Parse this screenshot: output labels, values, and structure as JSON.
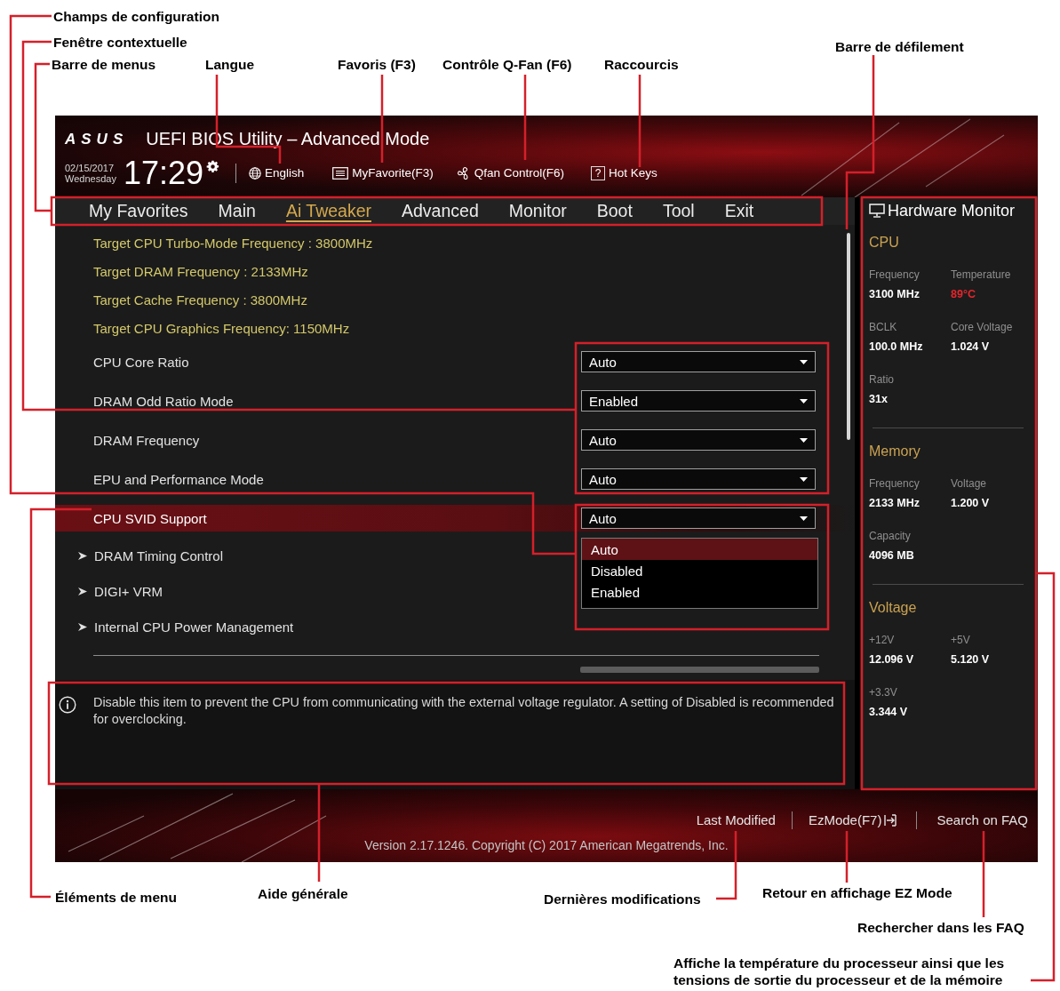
{
  "callouts": [
    {
      "text": "Champs de configuration"
    },
    {
      "text": "Fenêtre contextuelle"
    },
    {
      "text": "Barre de menus"
    },
    {
      "text": "Langue"
    },
    {
      "text": "Favoris (F3)"
    },
    {
      "text": "Contrôle Q-Fan (F6)"
    },
    {
      "text": "Raccourcis"
    },
    {
      "text": "Barre de défilement"
    },
    {
      "text": "Éléments de menu"
    },
    {
      "text": "Aide générale"
    },
    {
      "text": "Dernières modifications"
    },
    {
      "text": "Retour en affichage EZ Mode"
    },
    {
      "text": "Rechercher dans les FAQ"
    },
    {
      "text": "Affiche la température du processeur ainsi que les tensions de sortie du processeur et de la mémoire"
    }
  ],
  "header": {
    "logo": "ASUS",
    "title": "UEFI BIOS Utility – Advanced Mode",
    "date": "02/15/2017",
    "weekday": "Wednesday",
    "time": "17:29",
    "language": "English",
    "favorites": "MyFavorite(F3)",
    "qfan": "Qfan Control(F6)",
    "hot_keys_key": "?",
    "hot_keys": "Hot Keys"
  },
  "menu_tabs": [
    {
      "label": "My Favorites",
      "selected": false
    },
    {
      "label": "Main",
      "selected": false
    },
    {
      "label": "Ai Tweaker",
      "selected": true
    },
    {
      "label": "Advanced",
      "selected": false
    },
    {
      "label": "Monitor",
      "selected": false
    },
    {
      "label": "Boot",
      "selected": false
    },
    {
      "label": "Tool",
      "selected": false
    },
    {
      "label": "Exit",
      "selected": false
    }
  ],
  "settings": [
    {
      "kind": "info",
      "label": "Target CPU Turbo-Mode Frequency : 3800MHz",
      "selected": false
    },
    {
      "kind": "info",
      "label": "Target DRAM Frequency : 2133MHz",
      "selected": false
    },
    {
      "kind": "info",
      "label": "Target Cache Frequency : 3800MHz",
      "selected": false
    },
    {
      "kind": "info",
      "label": "Target CPU Graphics Frequency: 1150MHz",
      "selected": false
    },
    {
      "kind": "dropdown",
      "label": "CPU Core Ratio",
      "value": "Auto",
      "selected": false
    },
    {
      "kind": "dropdown",
      "label": "DRAM Odd Ratio Mode",
      "value": "Enabled",
      "selected": false
    },
    {
      "kind": "dropdown",
      "label": "DRAM Frequency",
      "value": "Auto",
      "selected": false
    },
    {
      "kind": "dropdown",
      "label": "EPU and Performance Mode",
      "value": "Auto",
      "selected": false
    },
    {
      "kind": "dropdown",
      "label": "CPU SVID Support",
      "value": "Auto",
      "selected": true,
      "expanded": true,
      "options": [
        {
          "label": "Auto",
          "selected": true
        },
        {
          "label": "Disabled",
          "selected": false
        },
        {
          "label": "Enabled",
          "selected": false
        }
      ]
    },
    {
      "kind": "submenu",
      "label": "DRAM Timing Control",
      "selected": false
    },
    {
      "kind": "submenu",
      "label": "DIGI+ VRM",
      "selected": false
    },
    {
      "kind": "submenu",
      "label": "Internal CPU Power Management",
      "selected": false
    },
    {
      "kind": "separator"
    },
    {
      "kind": "clipped"
    }
  ],
  "help": {
    "text": "Disable this item to prevent the CPU from communicating with the external voltage regulator. A setting of Disabled is recommended for overclocking."
  },
  "hardware_monitor": {
    "title": "Hardware Monitor",
    "sections": [
      {
        "heading": "CPU",
        "readings": [
          {
            "label": "Frequency",
            "value": "3100 MHz",
            "alert": false
          },
          {
            "label": "Temperature",
            "value": "89°C",
            "alert": true
          },
          {
            "label": "BCLK",
            "value": "100.0 MHz",
            "alert": false
          },
          {
            "label": "Core Voltage",
            "value": "1.024 V",
            "alert": false
          },
          {
            "label": "Ratio",
            "value": "31x",
            "alert": false
          }
        ]
      },
      {
        "heading": "Memory",
        "readings": [
          {
            "label": "Frequency",
            "value": "2133 MHz",
            "alert": false
          },
          {
            "label": "Voltage",
            "value": "1.200 V",
            "alert": false
          },
          {
            "label": "Capacity",
            "value": "4096 MB",
            "alert": false
          }
        ]
      },
      {
        "heading": "Voltage",
        "readings": [
          {
            "label": "+12V",
            "value": "12.096 V",
            "alert": false
          },
          {
            "label": "+5V",
            "value": "5.120 V",
            "alert": false
          },
          {
            "label": "+3.3V",
            "value": "3.344 V",
            "alert": false
          }
        ]
      }
    ]
  },
  "footer": {
    "last_modified": "Last Modified",
    "ez_mode": "EzMode(F7)",
    "search_faq": "Search on FAQ",
    "version": "Version 2.17.1246. Copyright (C) 2017 American Megatrends, Inc."
  }
}
